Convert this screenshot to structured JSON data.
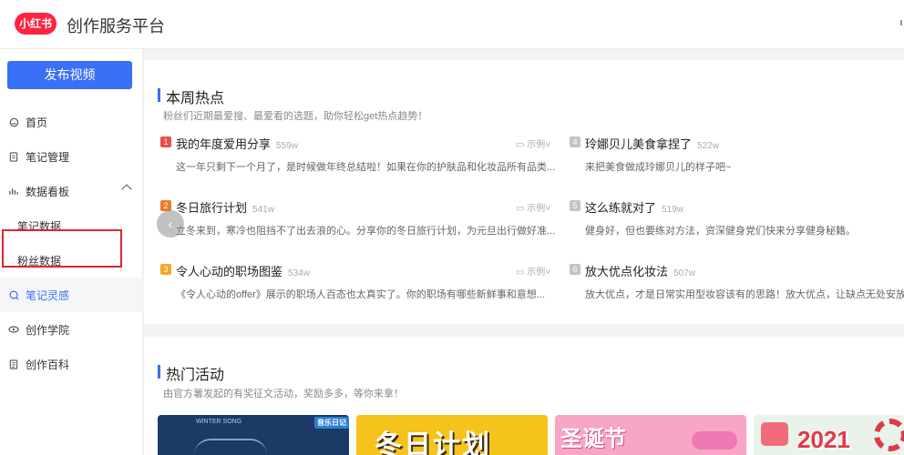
{
  "header": {
    "logo_text": "小红书",
    "title": "创作服务平台"
  },
  "sidebar": {
    "publish_label": "发布视频",
    "items": [
      {
        "label": "首页",
        "icon": "home-icon"
      },
      {
        "label": "笔记管理",
        "icon": "note-icon"
      },
      {
        "label": "数据看板",
        "icon": "chart-icon"
      },
      {
        "label": "笔记数据"
      },
      {
        "label": "粉丝数据"
      },
      {
        "label": "笔记灵感",
        "icon": "inspiration-icon"
      },
      {
        "label": "创作学院",
        "icon": "academy-icon"
      },
      {
        "label": "创作百科",
        "icon": "encyclopedia-icon"
      }
    ]
  },
  "hot": {
    "title": "本周热点",
    "subtitle": "粉丝们近期最爱搜、最爱看的选题，助你轻松get热点趋势！",
    "example_label": "示例",
    "topics": [
      {
        "rank": "1",
        "title": "我的年度爱用分享",
        "count": "559w",
        "desc": "这一年只剩下一个月了，是时候做年终总结啦！如果在你的护肤品和化妆品所有品类...",
        "color": "#f04a4a"
      },
      {
        "rank": "2",
        "title": "冬日旅行计划",
        "count": "541w",
        "desc": "立冬来到，寒冷也阻挡不了出去浪的心。分享你的冬日旅行计划，为元旦出行做好准...",
        "color": "#f07a2a"
      },
      {
        "rank": "3",
        "title": "令人心动的职场图鉴",
        "count": "534w",
        "desc": "《令人心动的offer》展示的职场人百态也太真实了。你的职场有哪些新鲜事和意想...",
        "color": "#f5a623"
      },
      {
        "rank": "4",
        "title": "玲娜贝儿美食拿捏了",
        "count": "522w",
        "desc": "来把美食做成玲娜贝儿的样子吧~",
        "color": "#c4c4c4"
      },
      {
        "rank": "5",
        "title": "这么练就对了",
        "count": "519w",
        "desc": "健身好，但也要练对方法，资深健身党们快来分享健身秘籍。",
        "color": "#c4c4c4"
      },
      {
        "rank": "6",
        "title": "放大优点化妆法",
        "count": "507w",
        "desc": "放大优点，才是日常实用型妆容该有的思路！放大优点，让缺点无处安放",
        "color": "#c4c4c4"
      }
    ]
  },
  "activities": {
    "title": "热门活动",
    "subtitle": "由官方薯发起的有奖征文活动，奖励多多，等你来拿！",
    "cards": [
      {
        "tag": "音乐日记",
        "caption": "WINTER SONG",
        "bg": "#1b3a66"
      },
      {
        "tag": "",
        "caption": "冬日计划",
        "bg": "#f6c21c"
      },
      {
        "tag": "",
        "caption": "圣诞节",
        "bg": "#f7a6c8"
      },
      {
        "tag": "",
        "caption": "2021",
        "bg": "#e9f3ea"
      }
    ]
  },
  "colors": {
    "accent": "#3a6ff7",
    "brand": "#ff2442",
    "highlight": "#e0242f"
  }
}
